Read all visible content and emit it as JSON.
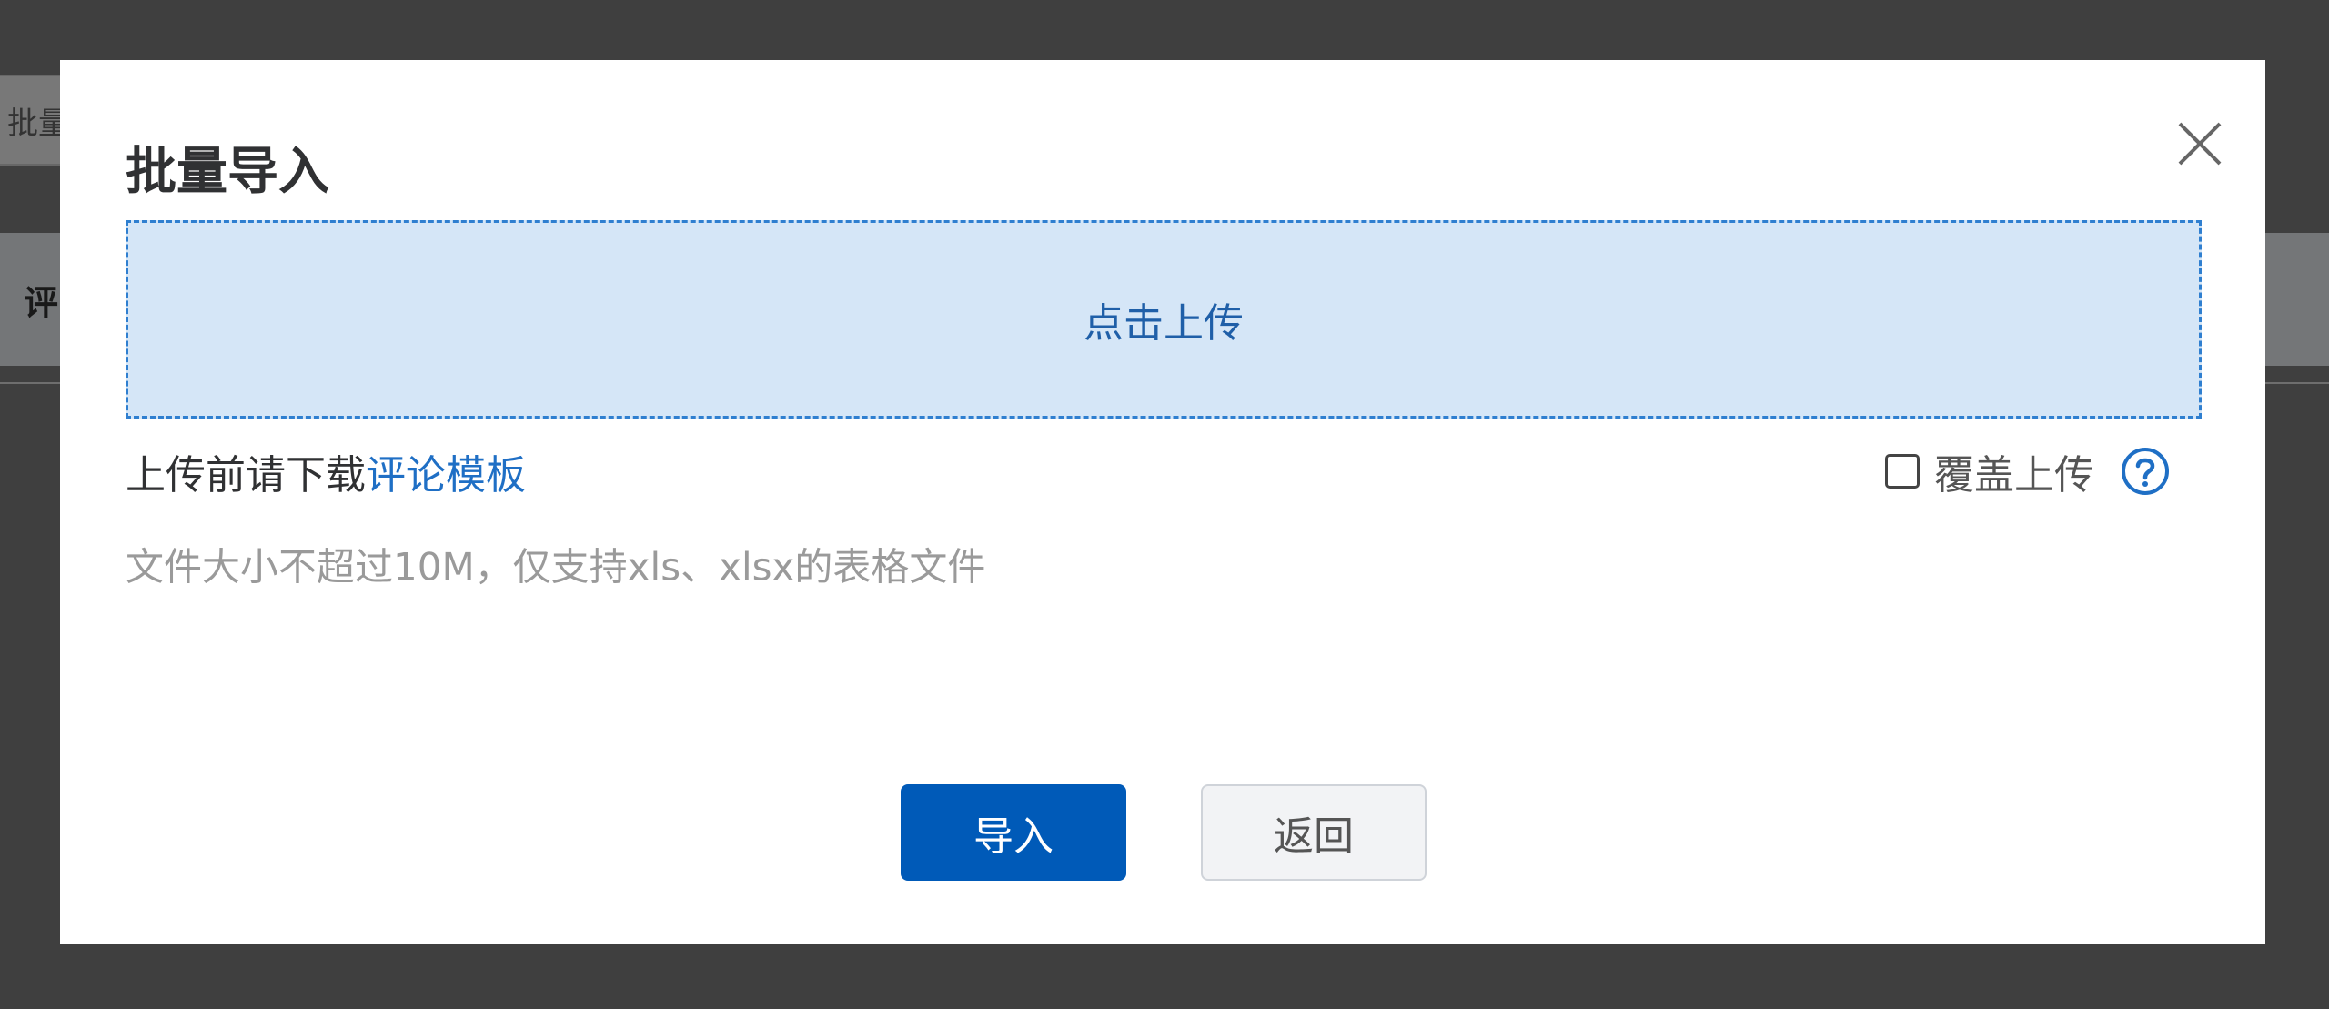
{
  "background": {
    "toolbar_button_fragment": "批量",
    "table_header_fragment": "评"
  },
  "dialog": {
    "title": "批量导入",
    "close_icon": "close-icon",
    "upload_zone_label": "点击上传",
    "template_prefix": "上传前请下载",
    "template_link": "评论模板",
    "overwrite_label": "覆盖上传",
    "overwrite_checked": false,
    "help_icon": "question-circle-icon",
    "hint": "文件大小不超过10M，仅支持xls、xlsx的表格文件",
    "import_button": "导入",
    "back_button": "返回"
  },
  "colors": {
    "primary": "#005ab8",
    "upload_bg": "#d5e6f7",
    "upload_border": "#2f7fd0",
    "link": "#1f6fc5",
    "hint": "#9a9a9a"
  }
}
